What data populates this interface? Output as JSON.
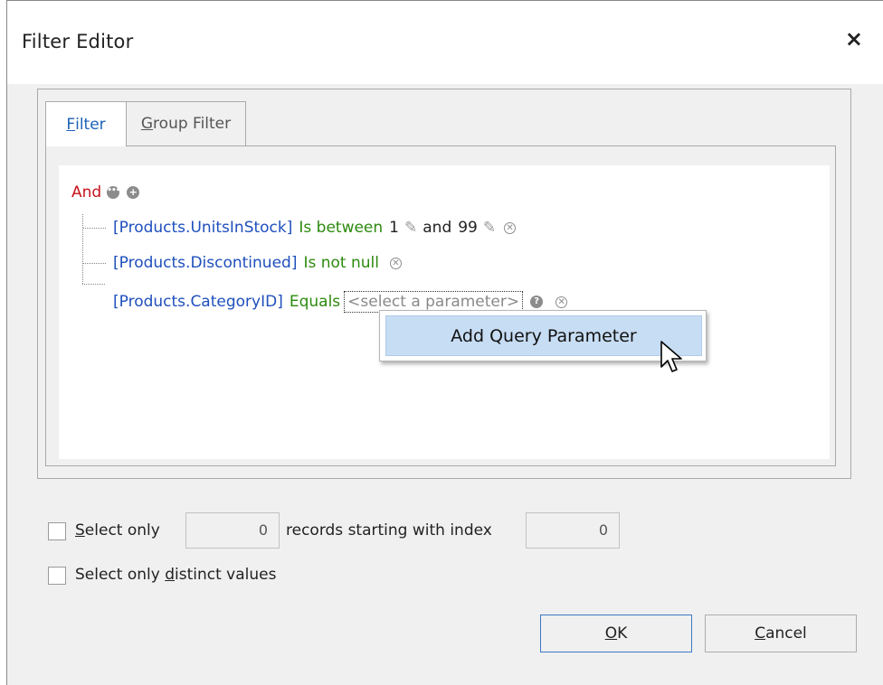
{
  "window": {
    "title": "Filter Editor",
    "close_label": "×"
  },
  "tabs": [
    {
      "label_pre": "",
      "label_u": "F",
      "label_post": "ilter"
    },
    {
      "label_pre": "",
      "label_u": "G",
      "label_post": "roup Filter"
    }
  ],
  "tree": {
    "root_operator": "And",
    "conditions": [
      {
        "field": "[Products.UnitsInStock]",
        "operator": "Is between",
        "value1": "1",
        "joiner": "and",
        "value2": "99"
      },
      {
        "field": "[Products.Discontinued]",
        "operator": "Is not null"
      },
      {
        "field": "[Products.CategoryID]",
        "operator": "Equals",
        "placeholder": "<select a parameter>"
      }
    ]
  },
  "context_menu": {
    "item": "Add Query Parameter"
  },
  "options": {
    "select_only_u": "S",
    "select_only_rest": "elect only",
    "top_count": "0",
    "records_label": "records starting with index",
    "start_index": "0",
    "distinct_pre": "Select only ",
    "distinct_u": "d",
    "distinct_post": "istinct values"
  },
  "buttons": {
    "ok_u": "O",
    "ok_rest": "K",
    "cancel_u": "C",
    "cancel_rest": "ancel"
  },
  "colors": {
    "operator_root": "#c8131b",
    "field": "#1f4fbd",
    "operation": "#2d8a0e",
    "menu_highlight": "#c7ddf4"
  },
  "icons": [
    "close-icon",
    "ellipsis-icon",
    "add-icon",
    "pencil-icon",
    "remove-icon",
    "help-icon",
    "mouse-pointer-icon"
  ]
}
